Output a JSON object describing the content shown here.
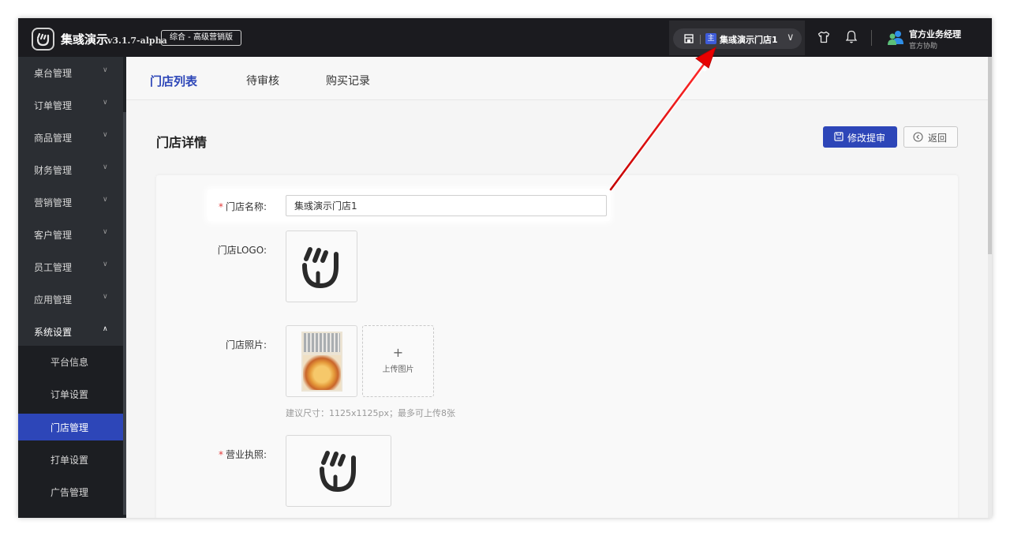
{
  "app": {
    "name": "集彧演示",
    "version": "v3.1.7-alpha",
    "edition": "综合 - 高级营销版"
  },
  "header": {
    "store_badge": "主",
    "store_name": "集彧演示门店1",
    "user_name": "官方业务经理",
    "user_role": "官方协助"
  },
  "sidebar": {
    "items": [
      {
        "label": "桌台管理"
      },
      {
        "label": "订单管理"
      },
      {
        "label": "商品管理"
      },
      {
        "label": "财务管理"
      },
      {
        "label": "营销管理"
      },
      {
        "label": "客户管理"
      },
      {
        "label": "员工管理"
      },
      {
        "label": "应用管理"
      },
      {
        "label": "系统设置"
      }
    ],
    "sub_items": [
      {
        "label": "平台信息"
      },
      {
        "label": "订单设置"
      },
      {
        "label": "门店管理"
      },
      {
        "label": "打单设置"
      },
      {
        "label": "广告管理"
      }
    ]
  },
  "tabs": [
    {
      "label": "门店列表"
    },
    {
      "label": "待审核"
    },
    {
      "label": "购买记录"
    }
  ],
  "page": {
    "title": "门店详情",
    "save_label": "修改提审",
    "back_label": "返回"
  },
  "form": {
    "required_mark": "*",
    "name_label": "门店名称:",
    "name_value": "集彧演示门店1",
    "logo_label": "门店LOGO:",
    "photo_label": "门店照片:",
    "upload_plus": "+",
    "upload_label": "上传图片",
    "photo_hint": "建议尺寸：1125x1125px；最多可上传8张",
    "license_label": "营业执照:"
  }
}
